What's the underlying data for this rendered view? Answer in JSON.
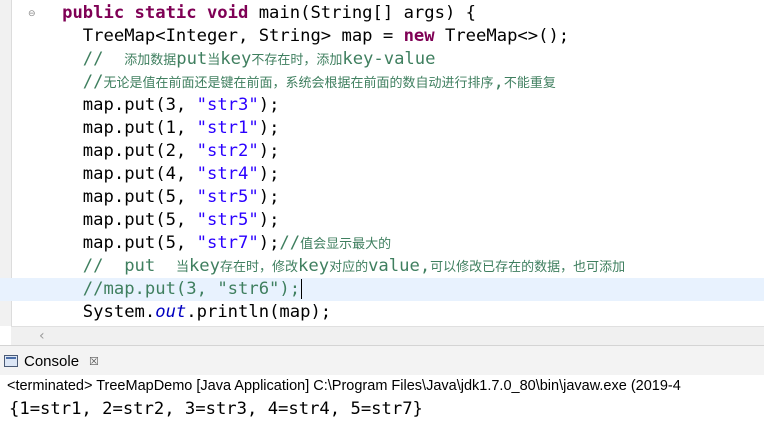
{
  "editor": {
    "lines": [
      {
        "indent": "      ",
        "parts": [
          {
            "t": "kw",
            "v": "public static void "
          },
          {
            "t": "txt",
            "v": "main(String[] args) {"
          }
        ]
      },
      {
        "indent": "        ",
        "parts": [
          {
            "t": "txt",
            "v": "TreeMap<Integer, String> map = "
          },
          {
            "t": "kw",
            "v": "new "
          },
          {
            "t": "txt",
            "v": "TreeMap<>();"
          }
        ]
      },
      {
        "indent": "        ",
        "parts": [
          {
            "t": "cm",
            "v": "//  "
          },
          {
            "t": "cmzh",
            "v": "添加数据"
          },
          {
            "t": "cm",
            "v": "put"
          },
          {
            "t": "cmzh",
            "v": "当"
          },
          {
            "t": "cm",
            "v": "key"
          },
          {
            "t": "cmzh",
            "v": "不存在时，添加"
          },
          {
            "t": "cm",
            "v": "key-value"
          }
        ]
      },
      {
        "indent": "        ",
        "parts": [
          {
            "t": "cm",
            "v": "//"
          },
          {
            "t": "cmzh",
            "v": "无论是值在前面还是键在前面，系统会根据在前面的数自动进行排序"
          },
          {
            "t": "cm",
            "v": ","
          },
          {
            "t": "cmzh",
            "v": "不能重复"
          }
        ]
      },
      {
        "indent": "        ",
        "parts": [
          {
            "t": "txt",
            "v": "map.put(3, "
          },
          {
            "t": "str",
            "v": "\"str3\""
          },
          {
            "t": "txt",
            "v": ");"
          }
        ]
      },
      {
        "indent": "        ",
        "parts": [
          {
            "t": "txt",
            "v": "map.put(1, "
          },
          {
            "t": "str",
            "v": "\"str1\""
          },
          {
            "t": "txt",
            "v": ");"
          }
        ]
      },
      {
        "indent": "        ",
        "parts": [
          {
            "t": "txt",
            "v": "map.put(2, "
          },
          {
            "t": "str",
            "v": "\"str2\""
          },
          {
            "t": "txt",
            "v": ");"
          }
        ]
      },
      {
        "indent": "        ",
        "parts": [
          {
            "t": "txt",
            "v": "map.put(4, "
          },
          {
            "t": "str",
            "v": "\"str4\""
          },
          {
            "t": "txt",
            "v": ");"
          }
        ]
      },
      {
        "indent": "        ",
        "parts": [
          {
            "t": "txt",
            "v": "map.put(5, "
          },
          {
            "t": "str",
            "v": "\"str5\""
          },
          {
            "t": "txt",
            "v": ");"
          }
        ]
      },
      {
        "indent": "        ",
        "parts": [
          {
            "t": "txt",
            "v": "map.put(5, "
          },
          {
            "t": "str",
            "v": "\"str5\""
          },
          {
            "t": "txt",
            "v": ");"
          }
        ]
      },
      {
        "indent": "        ",
        "parts": [
          {
            "t": "txt",
            "v": "map.put(5, "
          },
          {
            "t": "str",
            "v": "\"str7\""
          },
          {
            "t": "txt",
            "v": ");"
          },
          {
            "t": "cm",
            "v": "//"
          },
          {
            "t": "cmzh",
            "v": "值会显示最大的"
          }
        ]
      },
      {
        "indent": "        ",
        "parts": [
          {
            "t": "cm",
            "v": "//  put  "
          },
          {
            "t": "cmzh",
            "v": "当"
          },
          {
            "t": "cm",
            "v": "key"
          },
          {
            "t": "cmzh",
            "v": "存在时，修改"
          },
          {
            "t": "cm",
            "v": "key"
          },
          {
            "t": "cmzh",
            "v": "对应的"
          },
          {
            "t": "cm",
            "v": "value,"
          },
          {
            "t": "cmzh",
            "v": "可以修改已存在的数据，也可添加"
          }
        ]
      },
      {
        "indent": "        ",
        "current": true,
        "caret": true,
        "parts": [
          {
            "t": "cm",
            "v": "//map.put(3, \"str6\");"
          }
        ]
      },
      {
        "indent": "        ",
        "parts": [
          {
            "t": "txt",
            "v": "System."
          },
          {
            "t": "fld",
            "v": "out"
          },
          {
            "t": "txt",
            "v": ".println(map);"
          }
        ]
      }
    ]
  },
  "console": {
    "tab_label": "Console",
    "close_symbol": "☒",
    "status_line": "<terminated> TreeMapDemo [Java Application] C:\\Program Files\\Java\\jdk1.7.0_80\\bin\\javaw.exe (2019-4",
    "output": "{1=str1, 2=str2, 3=str3, 4=str4, 5=str7}"
  },
  "icons": {
    "fold": "fold-minus-icon",
    "scroll_left": "scroll-left-arrow-icon",
    "console": "console-icon"
  }
}
